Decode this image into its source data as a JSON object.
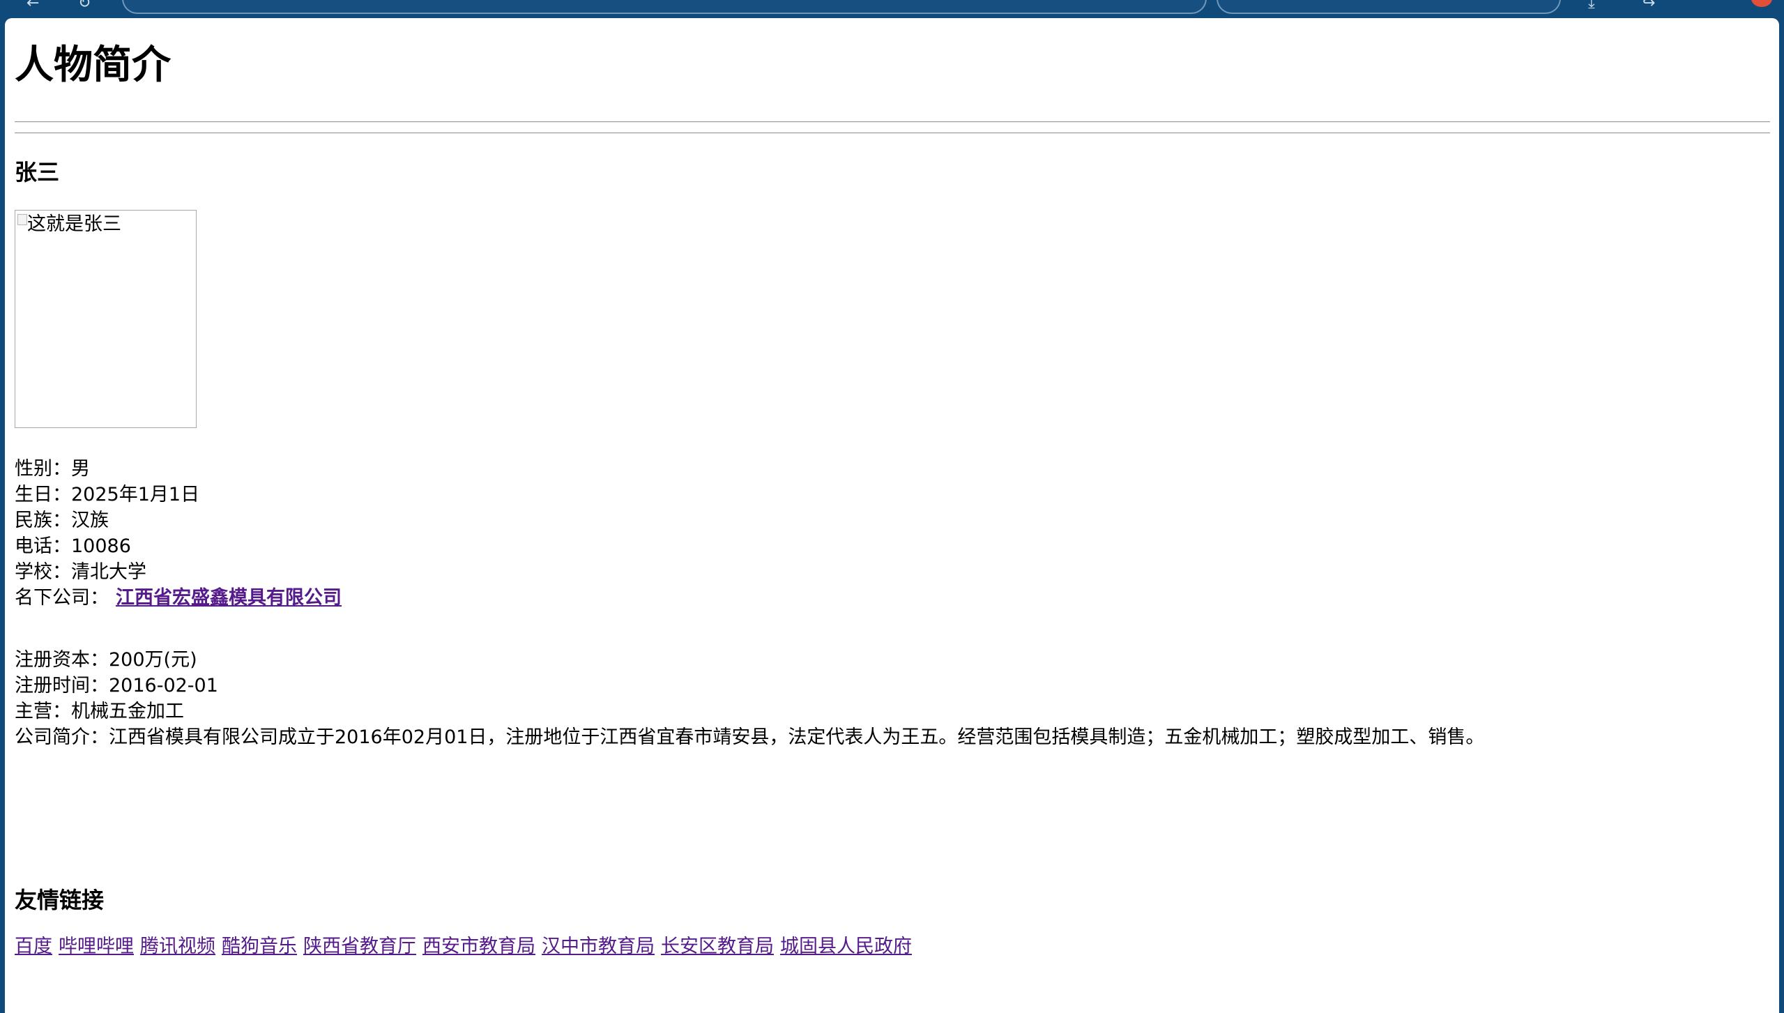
{
  "profile": {
    "page_title": "人物简介",
    "name": "张三",
    "photo_alt": "这就是张三",
    "fields": {
      "gender_label": "性别：",
      "gender": "男",
      "birthday_label": "生日：",
      "birthday": "2025年1月1日",
      "ethnicity_label": "民族：",
      "ethnicity": "汉族",
      "phone_label": "电话：",
      "phone": "10086",
      "school_label": "学校：",
      "school": "清北大学",
      "company_label": "名下公司：",
      "company": "江西省宏盛鑫模具有限公司"
    }
  },
  "company": {
    "capital_label": "注册资本：",
    "capital": "200万(元)",
    "registered_label": "注册时间：",
    "registered": "2016-02-01",
    "business_label": "主营：",
    "business": "机械五金加工",
    "intro_label": "公司简介：",
    "intro": "江西省模具有限公司成立于2016年02月01日，注册地位于江西省宜春市靖安县，法定代表人为王五。经营范围包括模具制造；五金机械加工；塑胶成型加工、销售。"
  },
  "friend_links": {
    "heading": "友情链接",
    "items": [
      "百度",
      "哔哩哔哩",
      "腾讯视频",
      "酷狗音乐",
      "陕西省教育厅",
      "西安市教育局",
      "汉中市教育局",
      "长安区教育局",
      "城固县人民政府"
    ]
  }
}
